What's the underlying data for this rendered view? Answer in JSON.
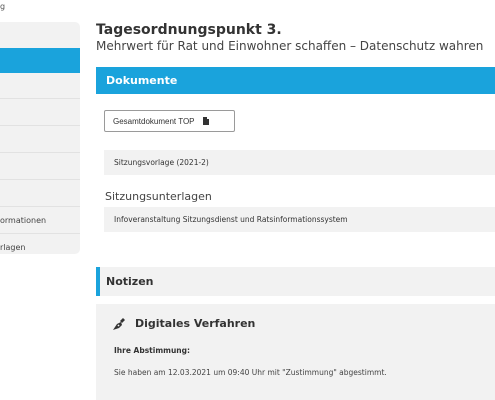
{
  "breadcrumb_fragment": "g",
  "sidebar": {
    "items": [
      {
        "label": ""
      },
      {
        "label": ""
      },
      {
        "label": ""
      },
      {
        "label": ""
      },
      {
        "label": ""
      },
      {
        "label": ""
      },
      {
        "label": "ormationen"
      },
      {
        "label": "rlagen"
      }
    ]
  },
  "heading": {
    "title": "Tagesordnungspunkt 3.",
    "subtitle": "Mehrwert für Rat und Einwohner schaffen – Datenschutz wahren"
  },
  "documents": {
    "header": "Dokumente",
    "button_label": "Gesamtdokument TOP",
    "rows": [
      "Sitzungsvorlage (2021-2)"
    ],
    "section_title": "Sitzungsunterlagen",
    "section_rows": [
      "Infoveranstaltung Sitzungsdienst und Ratsinformationssystem"
    ]
  },
  "notes": {
    "header": "Notizen",
    "title": "Digitales Verfahren",
    "vote_label": "Ihre Abstimmung:",
    "vote_text": "Sie haben am 12.03.2021 um 09:40 Uhr mit \"Zustimmung\" abgestimmt."
  },
  "colors": {
    "accent": "#1aa3dc",
    "panel_bg": "#f2f2f2"
  }
}
